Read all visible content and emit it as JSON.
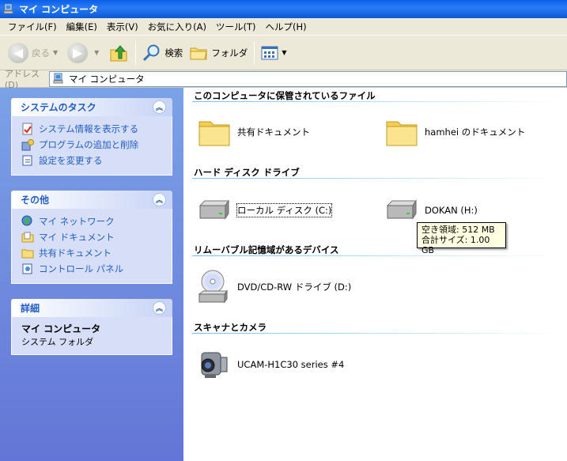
{
  "window": {
    "title": "マイ コンピュータ"
  },
  "menu": [
    "ファイル(F)",
    "編集(E)",
    "表示(V)",
    "お気に入り(A)",
    "ツール(T)",
    "ヘルプ(H)"
  ],
  "toolbar": {
    "back": "戻る",
    "search": "検索",
    "folders": "フォルダ"
  },
  "address": {
    "label": "アドレス(D)",
    "value": "マイ コンピュータ"
  },
  "sidebar": {
    "tasks": {
      "title": "システムのタスク",
      "items": [
        "システム情報を表示する",
        "プログラムの追加と削除",
        "設定を変更する"
      ]
    },
    "other": {
      "title": "その他",
      "items": [
        "マイ ネットワーク",
        "マイ ドキュメント",
        "共有ドキュメント",
        "コントロール パネル"
      ]
    },
    "details": {
      "title": "詳細",
      "name": "マイ コンピュータ",
      "type": "システム フォルダ"
    }
  },
  "groups": {
    "files": {
      "title": "このコンピュータに保管されているファイル",
      "items": [
        "共有ドキュメント",
        "hamhei のドキュメント"
      ]
    },
    "hdd": {
      "title": "ハード ディスク ドライブ",
      "items": [
        "ローカル ディスク (C:)",
        "DOKAN (H:)"
      ]
    },
    "removable": {
      "title": "リムーバブル記憶域があるデバイス",
      "items": [
        "DVD/CD-RW ドライブ (D:)"
      ]
    },
    "scanners": {
      "title": "スキャナとカメラ",
      "items": [
        "UCAM-H1C30 series #4"
      ]
    }
  },
  "tooltip": {
    "line1": "空き領域: 512 MB",
    "line2": "合計サイズ: 1.00 GB"
  }
}
